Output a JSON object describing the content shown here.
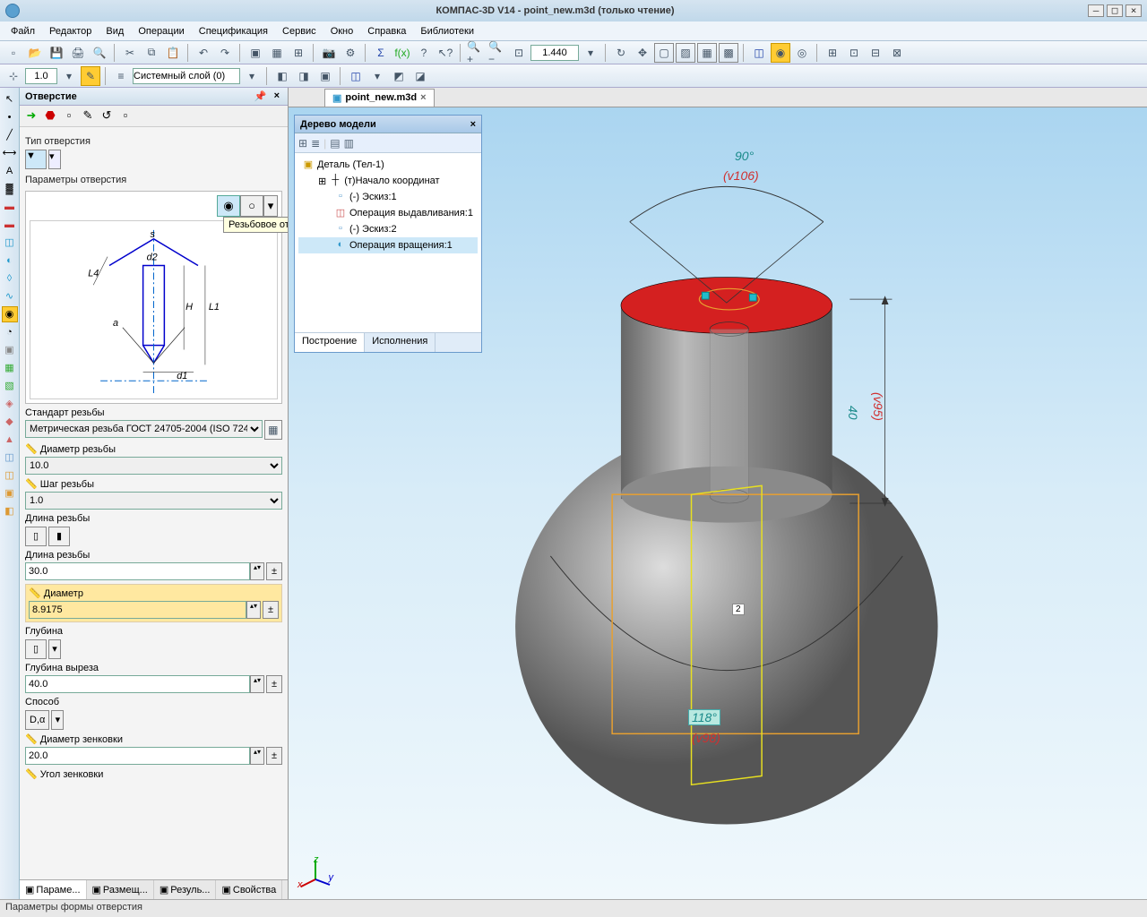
{
  "title": "КОМПАС-3D V14 - point_new.m3d (только чтение)",
  "menu": [
    "Файл",
    "Редактор",
    "Вид",
    "Операции",
    "Спецификация",
    "Сервис",
    "Окно",
    "Справка",
    "Библиотеки"
  ],
  "zoom": "1.440",
  "layer_value": "1.0",
  "layer_style": "Системный слой (0)",
  "panel": {
    "title": "Отверстие",
    "section_type": "Тип отверстия",
    "section_params": "Параметры отверстия",
    "tooltip": "Резьбовое отверстие",
    "diagram_labels": {
      "s": "s",
      "l4": "L4",
      "d2": "d2",
      "a": "a",
      "h": "H",
      "l1": "L1",
      "d1": "d1"
    },
    "thread_std_label": "Стандарт резьбы",
    "thread_std_value": "Метрическая резьба ГОСТ 24705-2004 (ISO 724",
    "diam_thread_label": "Диаметр резьбы",
    "diam_thread_value": "10.0",
    "pitch_label": "Шаг резьбы",
    "pitch_value": "1.0",
    "len_label": "Длина резьбы",
    "len2_label": "Длина резьбы",
    "len_value": "30.0",
    "diam_label": "Диаметр",
    "diam_value": "8.9175",
    "depth_label": "Глубина",
    "depth_cut_label": "Глубина выреза",
    "depth_cut_value": "40.0",
    "method_label": "Способ",
    "method_value": "D,α",
    "csink_d_label": "Диаметр зенковки",
    "csink_d_value": "20.0",
    "csink_a_label": "Угол зенковки",
    "tabs": [
      "Параме...",
      "Размещ...",
      "Резуль...",
      "Свойства"
    ]
  },
  "doctab": "point_new.m3d",
  "tree": {
    "title": "Дерево модели",
    "root": "Деталь (Тел-1)",
    "items": [
      "(т)Начало координат",
      "(-) Эскиз:1",
      "Операция выдавливания:1",
      "(-) Эскиз:2",
      "Операция вращения:1"
    ],
    "tabs": [
      "Построение",
      "Исполнения"
    ]
  },
  "scene": {
    "angle_top": "90°",
    "var_top": "(v106)",
    "dim_right": "40",
    "var_right": "(v95)",
    "angle_bottom": "118°",
    "var_bottom": "(v98)",
    "box_num": "2"
  },
  "axis": {
    "x": "x",
    "y": "y",
    "z": "z"
  },
  "status": "Параметры формы отверстия"
}
